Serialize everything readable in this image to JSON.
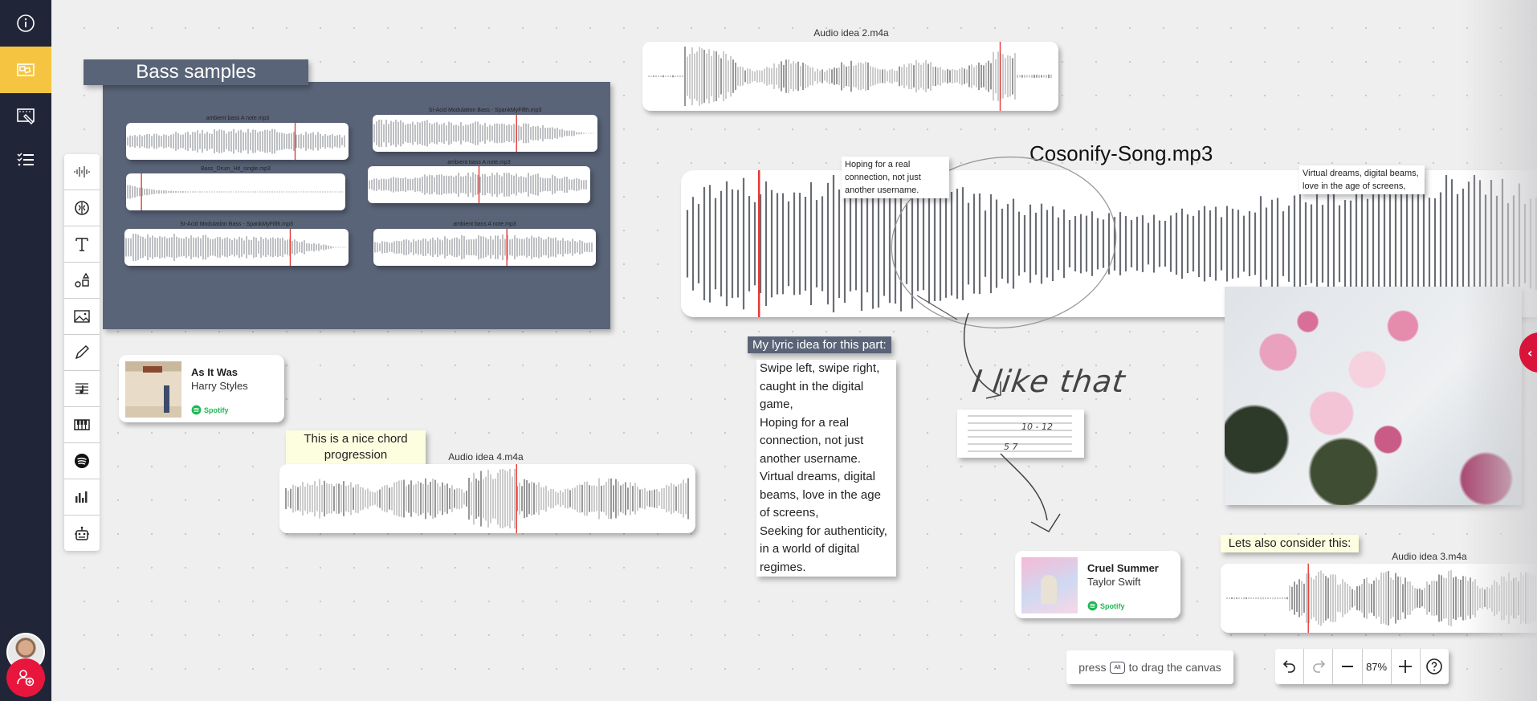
{
  "rail": {
    "items": [
      {
        "name": "info",
        "icon": "info-icon",
        "active": false
      },
      {
        "name": "media-board",
        "icon": "media-board-icon",
        "active": true
      },
      {
        "name": "canvas-edit",
        "icon": "canvas-edit-icon",
        "active": false
      },
      {
        "name": "tasks",
        "icon": "checklist-icon",
        "active": false
      }
    ],
    "avatar": "user-avatar",
    "add_user": "add-user-icon"
  },
  "toolbar": {
    "tools": [
      {
        "name": "audio",
        "icon": "waveform-icon"
      },
      {
        "name": "ai-brain",
        "icon": "brain-icon"
      },
      {
        "name": "text",
        "icon": "text-icon"
      },
      {
        "name": "shapes",
        "icon": "shapes-icon"
      },
      {
        "name": "image",
        "icon": "image-icon"
      },
      {
        "name": "draw",
        "icon": "pencil-icon"
      },
      {
        "name": "sheet-music",
        "icon": "sheet-music-icon"
      },
      {
        "name": "piano",
        "icon": "keyboard-icon"
      },
      {
        "name": "spotify",
        "icon": "spotify-icon"
      },
      {
        "name": "equalizer",
        "icon": "equalizer-icon"
      },
      {
        "name": "robot",
        "icon": "robot-icon"
      }
    ]
  },
  "bass_group": {
    "title": "Bass samples",
    "samples": [
      {
        "name": "ambient bass A note.mp3",
        "playhead": 0.76
      },
      {
        "name": "SI-Acid Modulation Bass - SpankMyFifth.mp3",
        "playhead": 0.64
      },
      {
        "name": "Bass_Drum_Hit_single.mp3",
        "playhead": 0.07
      },
      {
        "name": "ambient bass A note.mp3",
        "playhead": 0.5
      },
      {
        "name": "SI-Acid Modulation Bass - SpankMyFifth.mp3",
        "playhead": 0.74
      },
      {
        "name": "ambient bass A note.mp3",
        "playhead": 0.6
      }
    ]
  },
  "audio_clips": [
    {
      "id": "audio2",
      "title": "Audio idea 2.m4a",
      "playhead": 0.86
    },
    {
      "id": "song",
      "title": "Cosonify-Song.mp3",
      "playhead": 0.09
    },
    {
      "id": "audio4",
      "title": "Audio idea 4.m4a",
      "playhead": 0.57
    },
    {
      "id": "audio3",
      "title": "Audio idea 3.m4a",
      "playhead": 0.26
    }
  ],
  "spotify": [
    {
      "title": "As It Was",
      "artist": "Harry Styles",
      "source": "Spotify"
    },
    {
      "title": "Cruel Summer",
      "artist": "Taylor Swift",
      "source": "Spotify"
    }
  ],
  "notes": {
    "chord": "This is a nice chord progression",
    "consider": "Lets also consider this:"
  },
  "song_comments": [
    "Hoping for a real connection, not just another username.",
    "Virtual dreams, digital beams, love in the age of screens,"
  ],
  "lyrics": {
    "heading": "My lyric idea for this part:",
    "lines": [
      "Swipe left, swipe right, caught in the digital game,",
      "Hoping for a real connection, not just another username.",
      "Virtual dreams, digital beams, love in the age of screens,",
      "Seeking for authenticity, in a world of digital regimes."
    ]
  },
  "handwriting": {
    "comment": "I like that",
    "tab_top": "10 - 12",
    "tab_bottom": "5  7"
  },
  "image": {
    "alt": "pink-blossoms-photo"
  },
  "bottom": {
    "hint_before": "press",
    "hint_key": "Alt",
    "hint_after": "to drag the canvas",
    "zoom": "87%"
  },
  "colors": {
    "rail_bg": "#202637",
    "rail_active": "#f5c542",
    "group_bg": "#5a6478",
    "playhead": "#e53935",
    "accent_red": "#e8163d",
    "spotify_green": "#1db954",
    "note_yellow": "#fdfde0"
  }
}
